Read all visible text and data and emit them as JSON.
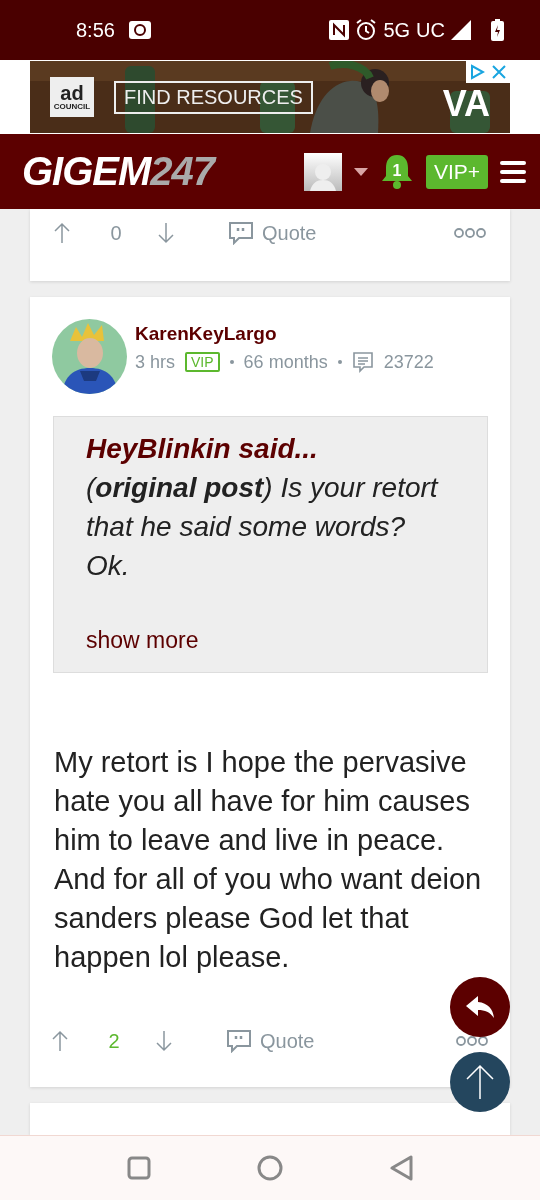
{
  "status_bar": {
    "time": "8:56",
    "network": "5G",
    "carrier": "UC"
  },
  "ad": {
    "brand": "ad",
    "brand_sub": "COUNCIL",
    "button": "FIND RESOURCES",
    "sponsor": "VA"
  },
  "header": {
    "logo_main": "GIGEM",
    "logo_suffix": "247",
    "notifications": "1",
    "vip_button": "VIP+"
  },
  "posts": [
    {
      "kind": "partial",
      "score": "0",
      "score_positive": false,
      "quote_label": "Quote"
    },
    {
      "kind": "full",
      "author": "KarenKeyLargo",
      "time": "3 hrs",
      "badge": "VIP",
      "tenure": "66 months",
      "post_count": "23722",
      "quote": {
        "author": "HeyBlinkin said...",
        "text": "(**original post**) Is your retort that he said some words? Ok.",
        "more": "show more"
      },
      "body": "My retort is I hope the pervasive hate you all have for him causes him to leave and live in peace. And for all of you who want deion sanders please God let that happen lol please.",
      "score": "2",
      "score_positive": true,
      "quote_label": "Quote"
    }
  ]
}
